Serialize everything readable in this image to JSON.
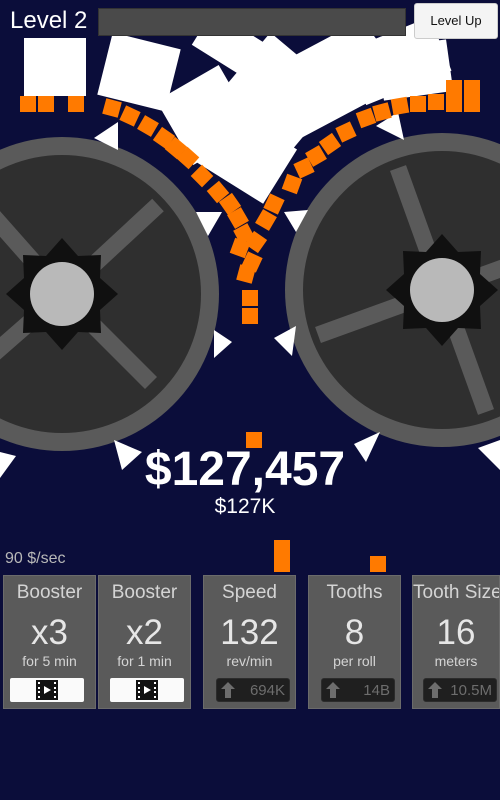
{
  "top": {
    "level_label": "Level 2",
    "level_up_label": "Level Up",
    "progress": 0
  },
  "money": {
    "amount": "$127,457",
    "short": "$127K",
    "rate": "90 $/sec"
  },
  "panels": [
    {
      "title": "Booster",
      "value": "x3",
      "unit": "for 5 min",
      "action": "watch-ad"
    },
    {
      "title": "Booster",
      "value": "x2",
      "unit": "for 1 min",
      "action": "watch-ad"
    },
    {
      "title": "Speed",
      "value": "132",
      "unit": "rev/min",
      "cost": "694K"
    },
    {
      "title": "Tooths",
      "value": "8",
      "unit": "per roll",
      "cost": "14B"
    },
    {
      "title": "Tooth Size",
      "value": "16",
      "unit": "meters",
      "cost": "10.5M"
    }
  ],
  "colors": {
    "background": "#0b0d3a",
    "roller_rim": "#5a5a5a",
    "roller_face": "#2f2f2f",
    "hub": "#b9b9b9",
    "gear": "#101010",
    "crate": "#ffffff",
    "chip": "#ff7a00",
    "progress_fill": "#0d5462"
  }
}
